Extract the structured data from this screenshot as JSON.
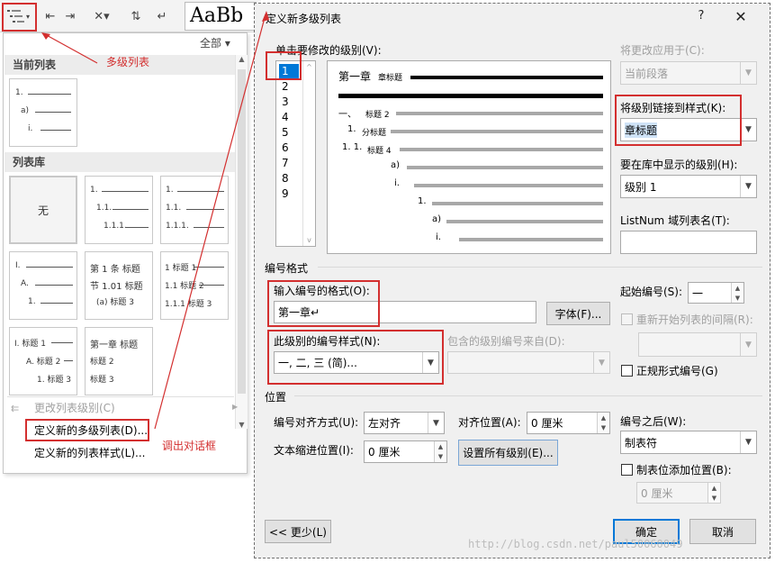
{
  "ribbon": {
    "multilevel_icon": "multilevel-list-icon",
    "style_preview": "AaBb"
  },
  "panel": {
    "filter": "全部 ▾",
    "current_header": "当前列表",
    "library_header": "列表库",
    "none_label": "无",
    "current_tile": [
      "1.",
      "a)",
      "i."
    ],
    "tiles": [
      [
        "1.",
        "1.1.",
        "1.1.1."
      ],
      [
        "1.",
        "1.1.",
        "1.1.1."
      ],
      [
        "I.",
        "A.",
        "1."
      ],
      [
        "第 1 条 标题",
        "节 1.01 标题",
        "(a) 标题 3"
      ],
      [
        "1 标题 1",
        "1.1 标题 2",
        "1.1.1 标题 3"
      ],
      [
        "I. 标题 1",
        "A. 标题 2",
        "1. 标题 3"
      ],
      [
        "第一章 标题",
        "标题 2",
        "标题 3"
      ]
    ],
    "change_level": "更改列表级别(C)",
    "define_new_list": "定义新的多级列表(D)...",
    "define_new_style": "定义新的列表样式(L)..."
  },
  "annotations": {
    "multilevel": "多级列表",
    "open_dialog": "调出对话框"
  },
  "dialog": {
    "title": "定义新多级列表",
    "help": "?",
    "close": "✕",
    "click_level_label": "单击要修改的级别(V):",
    "levels": [
      "1",
      "2",
      "3",
      "4",
      "5",
      "6",
      "7",
      "8",
      "9"
    ],
    "preview": {
      "row1": "第一章",
      "row1_small": "章标题",
      "rows": [
        {
          "num": "一、",
          "txt": "标题 2"
        },
        {
          "num": "1.",
          "txt": "分标题"
        },
        {
          "num": "1. 1.",
          "txt": "标题 4"
        },
        {
          "num": "a)",
          "txt": ""
        },
        {
          "num": "i.",
          "txt": ""
        },
        {
          "num": "1.",
          "txt": ""
        },
        {
          "num": "a)",
          "txt": ""
        },
        {
          "num": "i.",
          "txt": ""
        }
      ]
    },
    "apply_to_label": "将更改应用于(C):",
    "apply_to_value": "当前段落",
    "link_style_label": "将级别链接到样式(K):",
    "link_style_value": "章标题",
    "show_level_label": "要在库中显示的级别(H):",
    "show_level_value": "级别 1",
    "listnum_label": "ListNum 域列表名(T):",
    "listnum_value": "",
    "number_format_group": "编号格式",
    "enter_format_label": "输入编号的格式(O):",
    "enter_format_value": "第一章↵",
    "font_button": "字体(F)...",
    "number_style_label": "此级别的编号样式(N):",
    "number_style_value": "一, 二, 三 (简)...",
    "include_level_label": "包含的级别编号来自(D):",
    "start_at_label": "起始编号(S):",
    "start_at_value": "一",
    "restart_label": "重新开始列表的间隔(R):",
    "legal_label": "正规形式编号(G)",
    "position_group": "位置",
    "alignment_label": "编号对齐方式(U):",
    "alignment_value": "左对齐",
    "aligned_at_label": "对齐位置(A):",
    "aligned_at_value": "0 厘米",
    "text_indent_label": "文本缩进位置(I):",
    "text_indent_value": "0 厘米",
    "set_all_button": "设置所有级别(E)...",
    "follow_label": "编号之后(W):",
    "follow_value": "制表符",
    "tab_stop_label": "制表位添加位置(B):",
    "tab_stop_value": "0 厘米",
    "less_button": "<< 更少(L)",
    "ok_button": "确定",
    "cancel_button": "取消"
  },
  "watermark": "http://blog.csdn.net/paul50060049",
  "colors": {
    "annotation": "#d32f2f",
    "selection": "#0078d7"
  }
}
